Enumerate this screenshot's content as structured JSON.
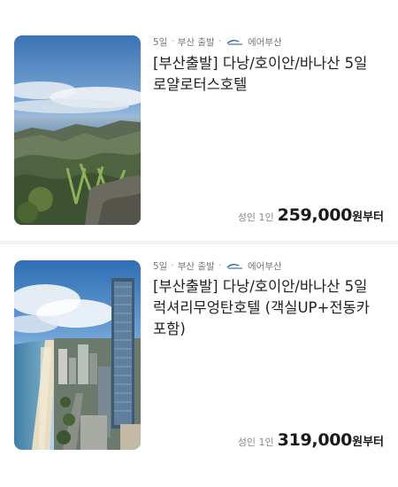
{
  "products": [
    {
      "meta": {
        "duration": "5일",
        "departure": "부산 출발",
        "airline": "에어부산"
      },
      "title": "[부산출발] 다낭/호이안/바나산 5일 로얄로터스호텔",
      "price": {
        "label": "성인 1인",
        "value": "259,000",
        "suffix": "원부터"
      },
      "image_icon": "coastal-mountain-photo"
    },
    {
      "meta": {
        "duration": "5일",
        "departure": "부산 출발",
        "airline": "에어부산"
      },
      "title": "[부산출발] 다낭/호이안/바나산 5일 럭셔리무엉탄호텔 (객실UP+전동카 포함)",
      "price": {
        "label": "성인 1인",
        "value": "319,000",
        "suffix": "원부터"
      },
      "image_icon": "beach-city-tower-photo"
    }
  ],
  "colors": {
    "meta": "#777777",
    "title": "#1f1f1f",
    "price": "#1a1a1a",
    "divider": "#f2f2f4"
  }
}
